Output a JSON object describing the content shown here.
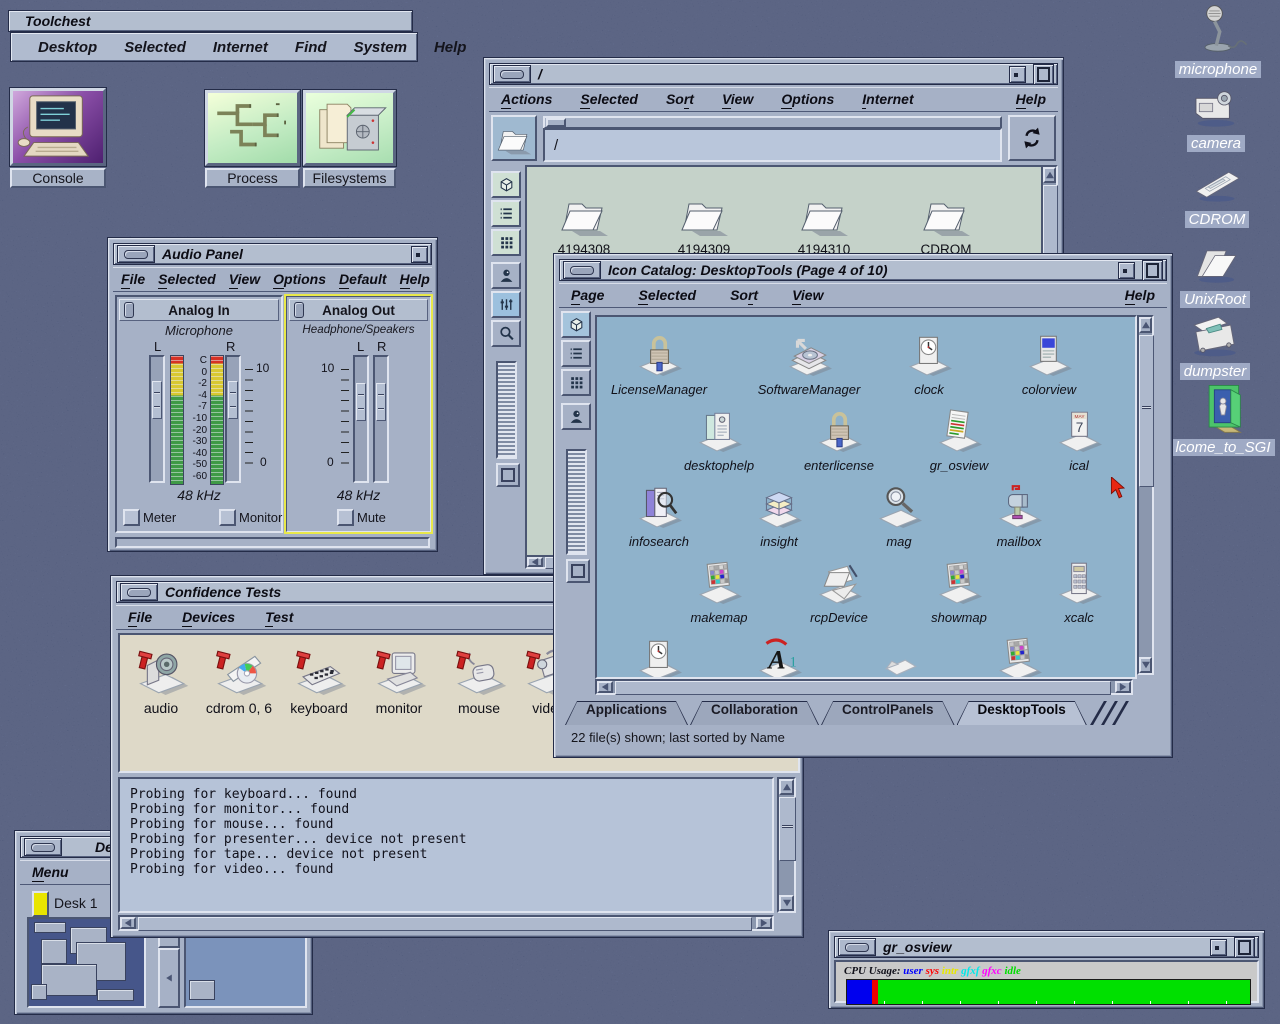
{
  "toolchest": {
    "title": "Toolchest",
    "menus": [
      {
        "label": "Desktop",
        "u": -1
      },
      {
        "label": "Selected",
        "u": -1
      },
      {
        "label": "Internet",
        "u": -1
      },
      {
        "label": "Find",
        "u": -1
      },
      {
        "label": "System",
        "u": -1
      },
      {
        "label": "Help",
        "u": -1
      }
    ]
  },
  "launchers": [
    {
      "label": "Console"
    },
    {
      "label": "Process"
    },
    {
      "label": "Filesystems"
    }
  ],
  "filemanager": {
    "title": "/",
    "menus": [
      {
        "label": "Actions",
        "u": 0
      },
      {
        "label": "Selected",
        "u": 0
      },
      {
        "label": "Sort",
        "u": 2
      },
      {
        "label": "View",
        "u": 0
      },
      {
        "label": "Options",
        "u": 0
      },
      {
        "label": "Internet",
        "u": 0
      },
      {
        "label": "Help",
        "u": 0
      }
    ],
    "path": "/",
    "folders": [
      "4194308",
      "4194309",
      "4194310",
      "CDROM"
    ]
  },
  "audio": {
    "title": "Audio Panel",
    "menus": [
      {
        "label": "File",
        "u": 0
      },
      {
        "label": "Selected",
        "u": 0
      },
      {
        "label": "View",
        "u": 0
      },
      {
        "label": "Options",
        "u": 0
      },
      {
        "label": "Default",
        "u": 0
      },
      {
        "label": "Help",
        "u": 0
      }
    ],
    "in": {
      "header": "Analog In",
      "device": "Microphone",
      "l": "L",
      "r": "R",
      "db_scale": [
        "C",
        "0",
        "-2",
        "-4",
        "-7",
        "-10",
        "-20",
        "-30",
        "-40",
        "-50",
        "-60"
      ],
      "gain_hi": "10",
      "gain_lo": "0",
      "rate": "48 kHz",
      "checks": [
        "Meter",
        "Monitor"
      ]
    },
    "out": {
      "header": "Analog Out",
      "device": "Headphone/Speakers",
      "l": "L",
      "r": "R",
      "gain_hi": "10",
      "gain_lo": "0",
      "rate": "48 kHz",
      "checks": [
        "Mute"
      ]
    }
  },
  "catalog": {
    "title": "Icon Catalog: DesktopTools (Page 4 of 10)",
    "menus": [
      {
        "label": "Page",
        "u": 0
      },
      {
        "label": "Selected",
        "u": 0
      },
      {
        "label": "Sort",
        "u": 2
      },
      {
        "label": "View",
        "u": 0
      },
      {
        "label": "Help",
        "u": 0
      }
    ],
    "icons": [
      {
        "label": "LicenseManager"
      },
      {
        "label": "SoftwareManager"
      },
      {
        "label": "clock"
      },
      {
        "label": "colorview"
      },
      {
        "label": "desktophelp"
      },
      {
        "label": "enterlicense"
      },
      {
        "label": "gr_osview"
      },
      {
        "label": "ical"
      },
      {
        "label": "infosearch"
      },
      {
        "label": "insight"
      },
      {
        "label": "mag"
      },
      {
        "label": "mailbox"
      },
      {
        "label": "makemap"
      },
      {
        "label": "rcpDevice"
      },
      {
        "label": "showmap"
      },
      {
        "label": "xcalc"
      }
    ],
    "tabs": [
      "Applications",
      "Collaboration",
      "ControlPanels",
      "DesktopTools"
    ],
    "status": "22 file(s) shown; last sorted by Name"
  },
  "confidence": {
    "title": "Confidence Tests",
    "menus": [
      {
        "label": "File",
        "u": 0
      },
      {
        "label": "Devices",
        "u": 0
      },
      {
        "label": "Test",
        "u": 0
      }
    ],
    "devices": [
      {
        "label": "audio"
      },
      {
        "label": "cdrom 0, 6"
      },
      {
        "label": "keyboard"
      },
      {
        "label": "monitor"
      },
      {
        "label": "mouse"
      },
      {
        "label": "video"
      }
    ],
    "log": [
      "Probing for keyboard... found",
      "Probing for monitor... found",
      "Probing for mouse... found",
      "Probing for presenter... device not present",
      "Probing for tape... device not present",
      "Probing for video... found"
    ]
  },
  "desks": {
    "title": "Desks",
    "menus": [
      {
        "label": "Menu",
        "u": 0
      }
    ],
    "desk1": "Desk 1"
  },
  "grosview": {
    "title": "gr_osview",
    "cpu_label": "CPU Usage:",
    "legend": [
      {
        "label": "user",
        "color": "#0000ff"
      },
      {
        "label": "sys",
        "color": "#ff0000"
      },
      {
        "label": "intr",
        "color": "#e8e800"
      },
      {
        "label": "gfxf",
        "color": "#00e8e8"
      },
      {
        "label": "gfxc",
        "color": "#ff00ff"
      },
      {
        "label": "idle",
        "color": "#00dd00"
      }
    ],
    "bar": [
      {
        "color": "#0000ee",
        "pct": 6.3
      },
      {
        "color": "#ee0000",
        "pct": 1.4
      },
      {
        "color": "#00e000",
        "pct": 92.3
      }
    ]
  },
  "shelf": [
    {
      "label": "microphone"
    },
    {
      "label": "camera"
    },
    {
      "label": "CDROM"
    },
    {
      "label": "UnixRoot"
    },
    {
      "label": "dumpster"
    },
    {
      "label": "lcome_to_SGI"
    }
  ]
}
